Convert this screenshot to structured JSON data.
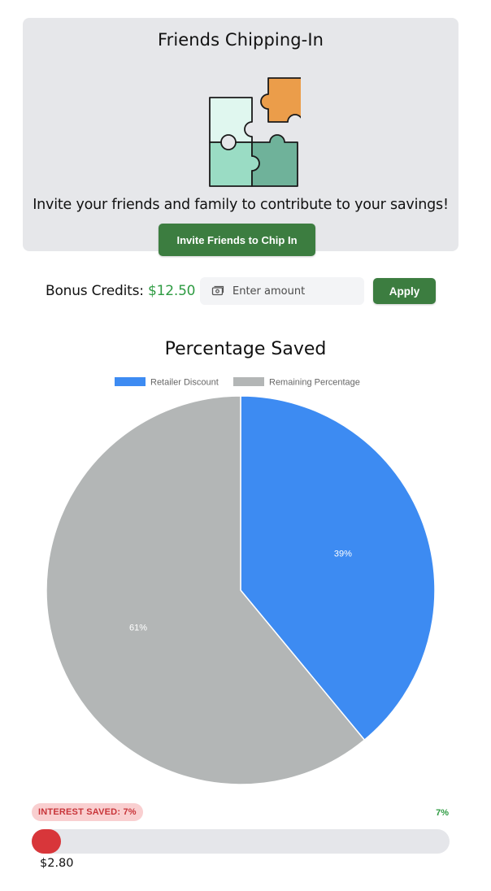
{
  "card": {
    "title": "Friends Chipping-In",
    "illustration": "puzzle-pieces-illustration",
    "text": "Invite your friends and family to contribute to your savings!",
    "invite_label": "Invite Friends to Chip In"
  },
  "credits": {
    "label": "Bonus Credits:",
    "value": "$12.50",
    "value_color": "#2e9b42",
    "amount_icon": "cash-icon",
    "amount_placeholder": "Enter amount",
    "apply_label": "Apply"
  },
  "colors": {
    "button_green": "#3c7d40",
    "progress_red": "#d8363a",
    "badge_bg": "#f9cfd0"
  },
  "chart_data": {
    "type": "pie",
    "title": "Percentage Saved",
    "legend_position": "top",
    "series": [
      {
        "name": "Retailer Discount",
        "value": 39,
        "label": "39%",
        "color": "#3d8bf2"
      },
      {
        "name": "Remaining Percentage",
        "value": 61,
        "label": "61%",
        "color": "#b3b6b6"
      }
    ]
  },
  "interest": {
    "badge": "INTEREST SAVED: 7%",
    "percent_label": "7%",
    "progress": 0.07,
    "amount": "$2.80"
  }
}
